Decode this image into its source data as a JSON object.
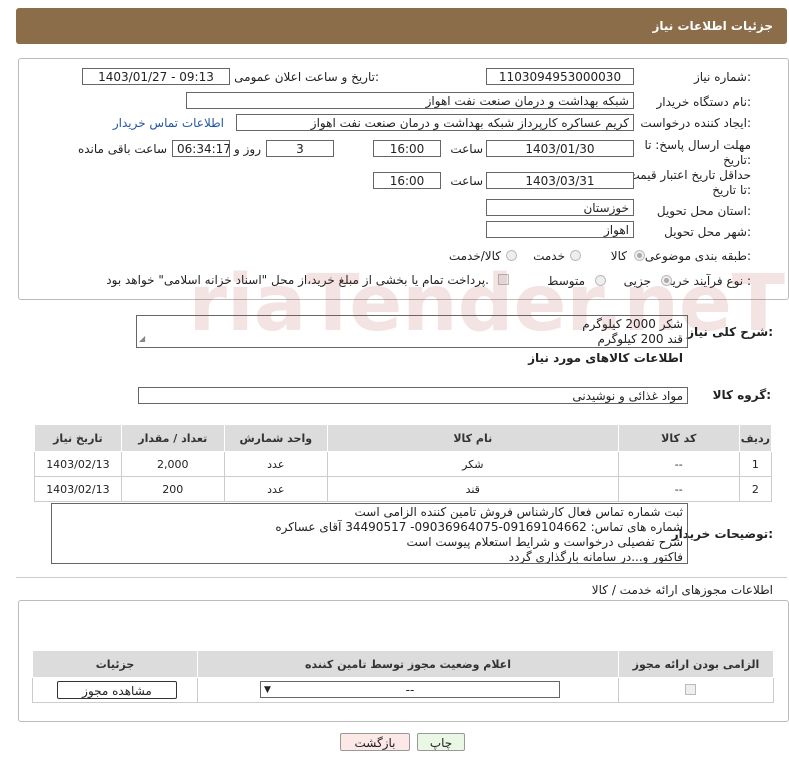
{
  "header": {
    "title": "جزئیات اطلاعات نیاز"
  },
  "form": {
    "need_number_label": "شماره نیاز:",
    "need_number": "1103094953000030",
    "announce_label": "تاریخ و ساعت اعلان عمومی:",
    "announce_value": "1403/01/27 - 09:13",
    "buyer_org_label": "نام دستگاه خریدار:",
    "buyer_org": "شبکه بهداشت و درمان صنعت نفت اهواز",
    "creator_label": "ایجاد کننده درخواست:",
    "creator": "کریم عساکره کارپرداز شبکه بهداشت و درمان صنعت نفت اهواز",
    "contact_link": "اطلاعات تماس خریدار",
    "reply_deadline_label": "مهلت ارسال پاسخ: تا تاریخ:",
    "reply_date": "1403/01/30",
    "time_label": "ساعت",
    "reply_time": "16:00",
    "days_value": "3",
    "days_label": "روز و",
    "remaining_time": "06:34:17",
    "remaining_label": "ساعت باقی مانده",
    "price_validity_label": "حداقل تاریخ اعتبار قیمت: تا تاریخ:",
    "price_date": "1403/03/31",
    "price_time": "16:00",
    "province_label": "استان محل تحویل:",
    "province": "خوزستان",
    "city_label": "شهر محل تحویل:",
    "city": "اهواز",
    "category_label": "طبقه بندی موضوعی:",
    "cat_options": [
      "کالا",
      "خدمت",
      "کالا/خدمت"
    ],
    "process_label": "نوع فرآیند خرید :",
    "process_options": [
      "جزیی",
      "متوسط"
    ],
    "payment_note": "پرداخت تمام یا بخشی از مبلغ خرید،از محل \"اسناد خزانه اسلامی\" خواهد بود."
  },
  "summary": {
    "label": "شرح کلی نیاز:",
    "line1": "شکر 2000 کیلوگرم",
    "line2": "قند 200 کیلوگرم"
  },
  "goods": {
    "section_title": "اطلاعات کالاهای مورد نیاز",
    "group_label": "گروه کالا:",
    "group_value": "مواد غذائی و نوشیدنی",
    "columns": [
      "ردیف",
      "کد کالا",
      "نام کالا",
      "واحد شمارش",
      "تعداد / مقدار",
      "تاریخ نیاز"
    ],
    "rows": [
      [
        "1",
        "--",
        "شکر",
        "عدد",
        "2,000",
        "1403/02/13"
      ],
      [
        "2",
        "--",
        "قند",
        "عدد",
        "200",
        "1403/02/13"
      ]
    ]
  },
  "notes": {
    "label": "توضیحات خریدار:",
    "line1": "ثبت شماره تماس فعال کارشناس فروش تامین کننده الزامی است",
    "line2": "شماره های تماس: 09169104662-09036964075- 34490517 آقای عساکره",
    "line3": "شرح تفصیلی درخواست و شرایط استعلام پیوست است",
    "line4": "فاکتور و...در سامانه بارگذاری گردد"
  },
  "permits": {
    "title": "اطلاعات مجوزهای ارائه خدمت / کالا",
    "columns": [
      "الزامی بودن ارائه مجوز",
      "اعلام وضعیت مجوز توسط تامین کننده",
      "جزئیات"
    ],
    "select_value": "--",
    "view_button": "مشاهده مجوز"
  },
  "buttons": {
    "print": "چاپ",
    "back": "بازگشت"
  },
  "watermark": {
    "text": "AriaTender.neT"
  }
}
